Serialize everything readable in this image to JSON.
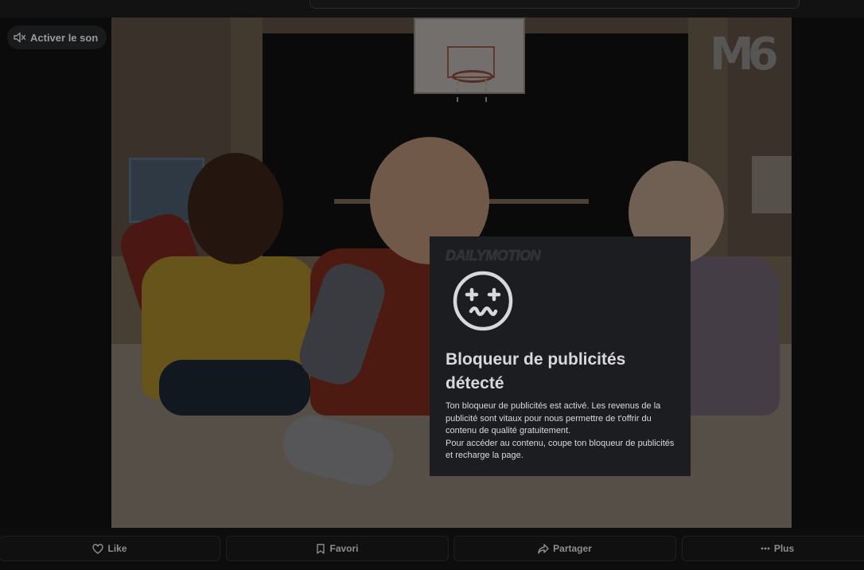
{
  "player_controls": {
    "unmute_label": "Activer le son",
    "unmute_icon": "speaker-muted-icon"
  },
  "video": {
    "channel_logo_text": "M6"
  },
  "adblock_modal": {
    "brand": "DAILYMOTION",
    "icon": "dizzy-face-icon",
    "title": "Bloqueur de publicités détecté",
    "paragraph_1": "Ton bloqueur de publicités est activé. Les revenus de la publicité sont vitaux pour nous permettre de t'offrir du contenu de qualité gratuitement.",
    "paragraph_2": "Pour accéder au contenu, coupe ton bloqueur de publicités et recharge la page."
  },
  "actions": [
    {
      "label": "Like",
      "icon": "heart-icon"
    },
    {
      "label": "Favori",
      "icon": "bookmark-icon"
    },
    {
      "label": "Partager",
      "icon": "share-icon"
    },
    {
      "label": "Plus",
      "icon": "more-dots-icon"
    }
  ],
  "colors": {
    "modal_bg": "#1c1d20",
    "page_bg": "#0b0b0c",
    "text_muted": "#8e8e92"
  }
}
